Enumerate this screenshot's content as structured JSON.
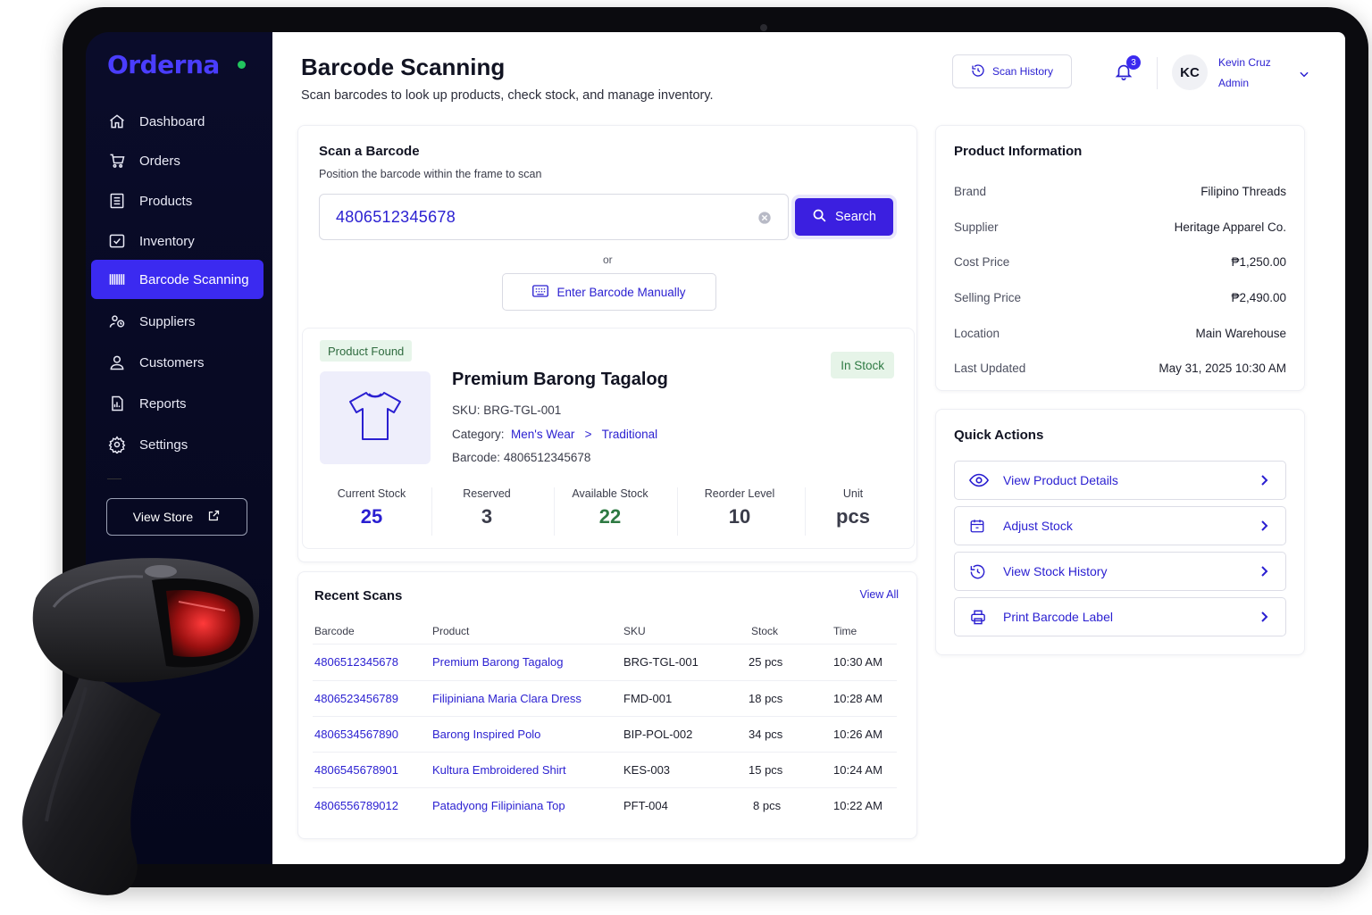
{
  "app": {
    "name": "Orderna"
  },
  "sidebar": {
    "items": [
      {
        "label": "Dashboard",
        "icon": "home-icon"
      },
      {
        "label": "Orders",
        "icon": "cart-icon"
      },
      {
        "label": "Products",
        "icon": "list-icon"
      },
      {
        "label": "Inventory",
        "icon": "inventory-icon"
      },
      {
        "label": "Barcode Scanning",
        "icon": "barcode-icon",
        "active": true
      },
      {
        "label": "Suppliers",
        "icon": "suppliers-icon"
      },
      {
        "label": "Customers",
        "icon": "user-icon"
      },
      {
        "label": "Reports",
        "icon": "reports-icon"
      },
      {
        "label": "Settings",
        "icon": "gear-icon"
      }
    ],
    "view_store": "View Store"
  },
  "header": {
    "title": "Barcode Scanning",
    "subtitle": "Scan barcodes to look up products, check stock, and manage inventory.",
    "scan_history": "Scan History",
    "notifications": "3",
    "user": {
      "initials": "KC",
      "name": "Kevin Cruz",
      "role": "Admin"
    }
  },
  "scan": {
    "title": "Scan a Barcode",
    "subtitle": "Position the barcode within the frame to scan",
    "input_value": "4806512345678",
    "search_label": "Search",
    "or_label": "or",
    "manual_label": "Enter Barcode Manually"
  },
  "product": {
    "found_label": "Product Found",
    "status": "In Stock",
    "name": "Premium Barong Tagalog",
    "sku_label": "SKU:",
    "sku": "BRG-TGL-001",
    "category_label": "Category:",
    "category": "Men's Wear",
    "category_sep": ">",
    "subcategory": "Traditional",
    "barcode_label": "Barcode:",
    "barcode": "4806512345678",
    "stats": [
      {
        "label": "Current Stock",
        "value": "25"
      },
      {
        "label": "Reserved",
        "value": "3"
      },
      {
        "label": "Available Stock",
        "value": "22"
      },
      {
        "label": "Reorder Level",
        "value": "10"
      },
      {
        "label": "Unit",
        "value": "pcs"
      }
    ]
  },
  "recent": {
    "title": "Recent Scans",
    "view_all": "View All",
    "columns": [
      "Barcode",
      "Product",
      "SKU",
      "Stock",
      "Time"
    ],
    "rows": [
      [
        "4806512345678",
        "Premium Barong Tagalog",
        "BRG-TGL-001",
        "25 pcs",
        "10:30 AM"
      ],
      [
        "4806523456789",
        "Filipiniana Maria Clara Dress",
        "FMD-001",
        "18 pcs",
        "10:28 AM"
      ],
      [
        "4806534567890",
        "Barong Inspired Polo",
        "BIP-POL-002",
        "34 pcs",
        "10:26 AM"
      ],
      [
        "4806545678901",
        "Kultura Embroidered Shirt",
        "KES-003",
        "15 pcs",
        "10:24 AM"
      ],
      [
        "4806556789012",
        "Patadyong Filipiniana Top",
        "PFT-004",
        "8 pcs",
        "10:22 AM"
      ]
    ]
  },
  "info": {
    "title": "Product Information",
    "rows": [
      {
        "label": "Brand",
        "value": "Filipino Threads"
      },
      {
        "label": "Supplier",
        "value": "Heritage Apparel Co."
      },
      {
        "label": "Cost Price",
        "value": "₱1,250.00"
      },
      {
        "label": "Selling Price",
        "value": "₱2,490.00"
      },
      {
        "label": "Location",
        "value": "Main Warehouse"
      },
      {
        "label": "Last Updated",
        "value": "May 31, 2025 10:30 AM"
      }
    ]
  },
  "quick_actions": {
    "title": "Quick Actions",
    "items": [
      {
        "label": "View Product Details",
        "icon": "eye-icon"
      },
      {
        "label": "Adjust Stock",
        "icon": "calendar-box-icon"
      },
      {
        "label": "View Stock History",
        "icon": "history-icon"
      },
      {
        "label": "Print Barcode Label",
        "icon": "printer-icon"
      }
    ]
  },
  "colors": {
    "accent": "#3b2af0",
    "link": "#2a1fd1",
    "sidebar_bg": "#070a24",
    "success": "#2e7a43"
  }
}
